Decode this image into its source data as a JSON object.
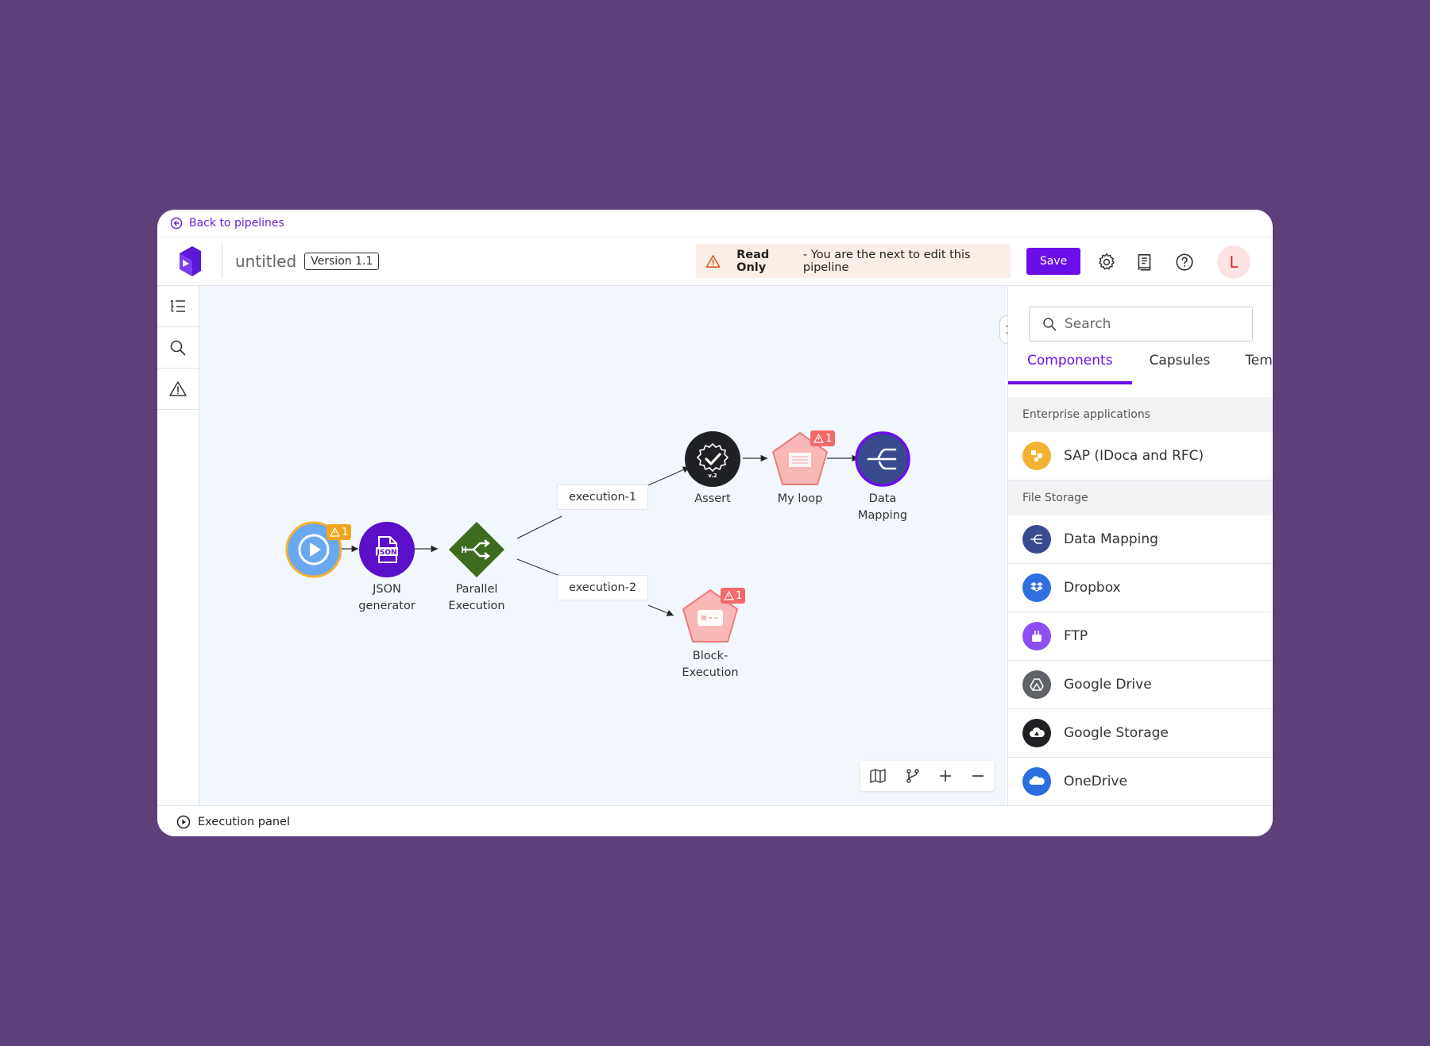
{
  "nav": {
    "back_label": "Back to pipelines"
  },
  "header": {
    "title": "untitled",
    "version": "Version 1.1",
    "notice_bold": "Read Only",
    "notice_text": "- You are the next to edit this pipeline",
    "save_label": "Save",
    "avatar_initial": "L"
  },
  "canvas": {
    "nodes": {
      "start": {
        "badge": "1"
      },
      "json": {
        "label": "JSON\ngenerator",
        "icon_text": "JSON"
      },
      "parallel": {
        "label": "Parallel\nExecution"
      },
      "assert": {
        "label": "Assert",
        "icon_text": "v.2"
      },
      "myloop": {
        "label": "My loop",
        "badge": "1"
      },
      "datamapping": {
        "label": "Data\nMapping"
      },
      "block": {
        "label": "Block-\nExecution",
        "badge": "1"
      }
    },
    "edge_labels": {
      "exec1": "execution-1",
      "exec2": "execution-2"
    }
  },
  "sidebar": {
    "search_placeholder": "Search",
    "tabs": [
      "Components",
      "Capsules",
      "Templates"
    ],
    "sections": [
      {
        "title": "Enterprise applications",
        "items": [
          {
            "name": "SAP (IDoca and RFC)",
            "icon": "sap-icon",
            "color": "#f3b22f"
          }
        ]
      },
      {
        "title": "File Storage",
        "items": [
          {
            "name": "Data Mapping",
            "icon": "data-mapping-icon",
            "color": "#3a4a8f"
          },
          {
            "name": "Dropbox",
            "icon": "dropbox-icon",
            "color": "#2f6fe0"
          },
          {
            "name": "FTP",
            "icon": "ftp-icon",
            "color": "#8b4ef0"
          },
          {
            "name": "Google Drive",
            "icon": "google-drive-icon",
            "color": "#5f6368"
          },
          {
            "name": "Google Storage",
            "icon": "google-storage-icon",
            "color": "#202124"
          },
          {
            "name": "OneDrive",
            "icon": "onedrive-icon",
            "color": "#2a6ee0"
          }
        ]
      }
    ]
  },
  "footer": {
    "exec_panel_label": "Execution panel"
  },
  "colors": {
    "accent": "#6a0fe8",
    "background": "#5d3f79",
    "canvas": "#f1f7fd",
    "warning_badge": "#f29f1e",
    "error_badge": "#f26a6a"
  }
}
